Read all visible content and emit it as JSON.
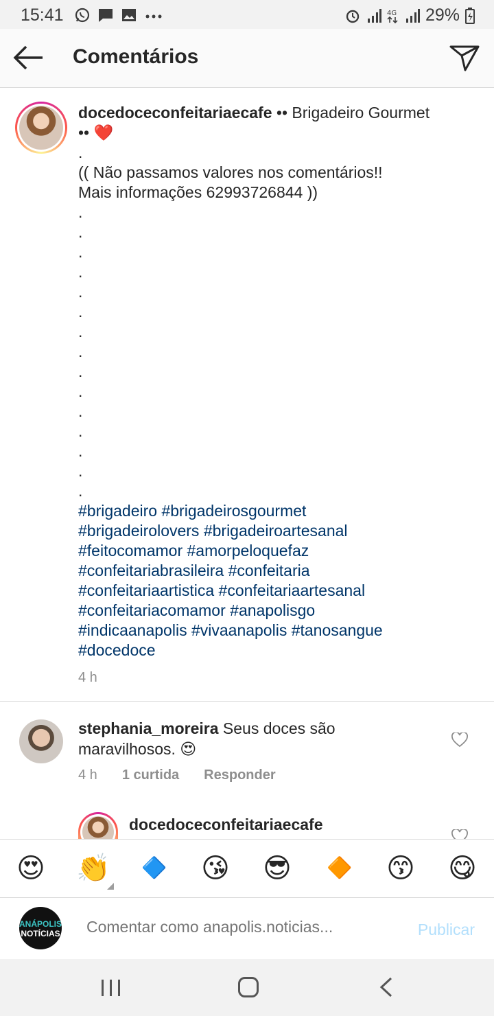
{
  "status_bar": {
    "time": "15:41",
    "left_icons": [
      "whatsapp-icon",
      "message-icon",
      "gallery-icon",
      "more-dots-icon"
    ],
    "right_icons": [
      "alarm-icon",
      "signal-icon",
      "4g-icon",
      "signal-icon"
    ],
    "battery": "29%"
  },
  "header": {
    "title": "Comentários",
    "back_icon": "arrow-left-icon",
    "send_icon": "paper-plane-icon"
  },
  "caption": {
    "username": "docedoceconfeitariaecafe",
    "first_text": " •• Brigadeiro Gourmet",
    "second_line": "•• ",
    "heart_emoji": "❤️",
    "text_lines": [
      ".",
      "(( Não passamos valores nos comentários!!",
      "Mais informações 62993726844 ))",
      ".",
      ".",
      ".",
      ".",
      ".",
      ".",
      ".",
      ".",
      ".",
      ".",
      ".",
      ".",
      ".",
      ".",
      "."
    ],
    "hashtag_lines": [
      "#brigadeiro #brigadeirosgourmet",
      "#brigadeirolovers #brigadeiroartesanal",
      "#feitocomamor #amorpeloquefaz",
      "#confeitariabrasileira #confeitaria",
      "#confeitariaartistica #confeitariaartesanal",
      "#confeitariacomamor #anapolisgo",
      "#indicaanapolis #vivaanapolis #tanosangue",
      "#docedoce"
    ],
    "time": "4 h"
  },
  "comments": [
    {
      "username": "stephania_moreira",
      "text": " Seus doces são",
      "text_line2": "maravilhosos. ",
      "emoji": "😍",
      "time": "4 h",
      "likes": "1 curtida",
      "reply_label": "Responder"
    }
  ],
  "reply": {
    "username": "docedoceconfeitariaecafe"
  },
  "emoji_bar": [
    "😍",
    "👏",
    "🔷",
    "😘",
    "😎",
    "🔶",
    "😙",
    "😋"
  ],
  "comment_input": {
    "avatar_text_1": "ANÁPOLIS",
    "avatar_text_2": "NOTÍCIAS",
    "placeholder": "Comentar como anapolis.noticias...",
    "publish_label": "Publicar"
  },
  "colors": {
    "hashtag": "#003569",
    "publish_disabled": "#b2dffc",
    "meta_gray": "#8e8e8e"
  }
}
